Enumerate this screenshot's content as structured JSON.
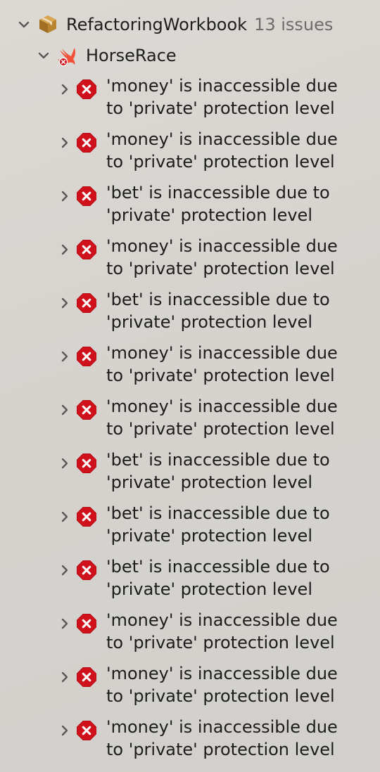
{
  "project": {
    "name": "RefactoringWorkbook",
    "count": "13 issues",
    "icon": "package-icon"
  },
  "target": {
    "name": "HorseRace",
    "icon": "swift-icon"
  },
  "colors": {
    "error_red": "#d0111b",
    "swift_orange": "#f05138",
    "package_brown": "#a9772c"
  },
  "issues": [
    {
      "line1": "'money' is inaccessible due",
      "line2": "to 'private' protection level"
    },
    {
      "line1": "'money' is inaccessible due",
      "line2": "to 'private' protection level"
    },
    {
      "line1": "'bet' is inaccessible due to",
      "line2": "'private' protection level"
    },
    {
      "line1": "'money' is inaccessible due",
      "line2": "to 'private' protection level"
    },
    {
      "line1": "'bet' is inaccessible due to",
      "line2": "'private' protection level"
    },
    {
      "line1": "'money' is inaccessible due",
      "line2": "to 'private' protection level"
    },
    {
      "line1": "'money' is inaccessible due",
      "line2": "to 'private' protection level"
    },
    {
      "line1": "'bet' is inaccessible due to",
      "line2": "'private' protection level"
    },
    {
      "line1": "'bet' is inaccessible due to",
      "line2": "'private' protection level"
    },
    {
      "line1": "'bet' is inaccessible due to",
      "line2": "'private' protection level"
    },
    {
      "line1": "'money' is inaccessible due",
      "line2": "to 'private' protection level"
    },
    {
      "line1": "'money' is inaccessible due",
      "line2": "to 'private' protection level"
    },
    {
      "line1": "'money' is inaccessible due",
      "line2": "to 'private' protection level"
    }
  ]
}
